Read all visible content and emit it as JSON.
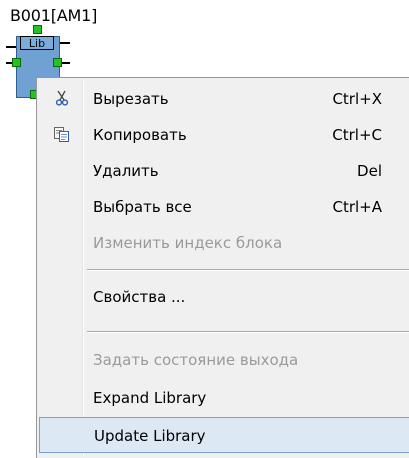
{
  "block": {
    "label": "B001[AM1]",
    "type_label": "Lib"
  },
  "menu": {
    "items": [
      {
        "label": "Вырезать",
        "shortcut": "Ctrl+X",
        "icon": "scissors-icon",
        "enabled": true
      },
      {
        "label": "Копировать",
        "shortcut": "Ctrl+C",
        "icon": "copy-icon",
        "enabled": true
      },
      {
        "label": "Удалить",
        "shortcut": "Del",
        "icon": "",
        "enabled": true
      },
      {
        "label": "Выбрать все",
        "shortcut": "Ctrl+A",
        "icon": "",
        "enabled": true
      },
      {
        "label": "Изменить индекс блока",
        "shortcut": "",
        "icon": "",
        "enabled": false
      },
      {
        "label": "Свойства ...",
        "shortcut": "",
        "icon": "",
        "enabled": true
      },
      {
        "label": "Задать состояние выхода",
        "shortcut": "",
        "icon": "",
        "enabled": false
      },
      {
        "label": "Expand Library",
        "shortcut": "",
        "icon": "",
        "enabled": true
      },
      {
        "label": "Update Library",
        "shortcut": "",
        "icon": "",
        "enabled": true,
        "selected": true
      }
    ]
  },
  "colors": {
    "menu_bg": "#f0f0f0",
    "highlight_bg": "#dde8f5",
    "highlight_border": "#7aa1d0",
    "disabled_text": "#9a9a9a",
    "block_fill": "#6fa1d3",
    "pin_green": "#22c322"
  }
}
